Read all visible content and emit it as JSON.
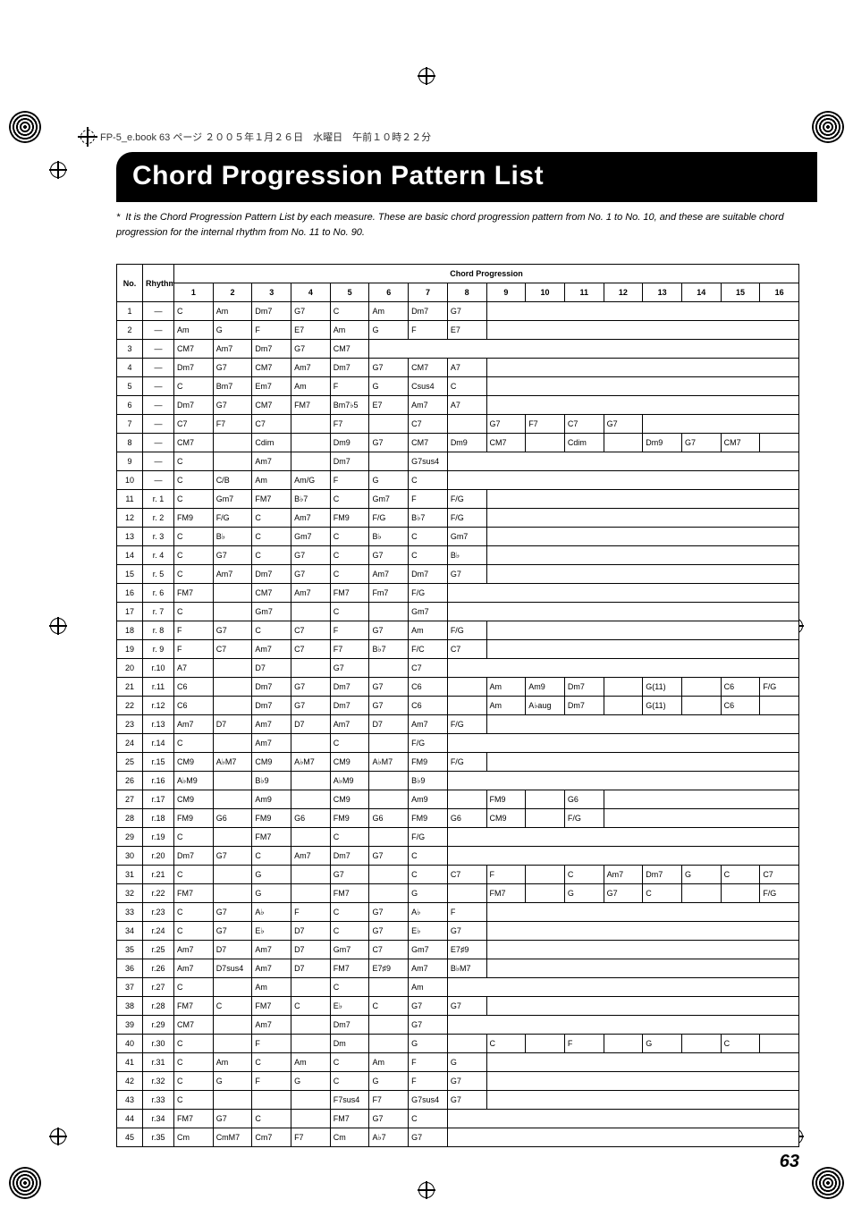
{
  "header": {
    "fileline": "FP-5_e.book 63 ページ ２００５年１月２６日　水曜日　午前１０時２２分"
  },
  "title": "Chord Progression Pattern List",
  "intro_prefix": "*",
  "intro": "It is the Chord Progression Pattern List by each measure. These are basic chord progression pattern from No. 1 to No. 10, and these are suitable chord progression for the internal rhythm from No. 11 to No. 90.",
  "table": {
    "head_no": "No.",
    "head_rhythm": "Rhythm No.",
    "head_chord": "Chord Progression",
    "cols": [
      "1",
      "2",
      "3",
      "4",
      "5",
      "6",
      "7",
      "8",
      "9",
      "10",
      "11",
      "12",
      "13",
      "14",
      "15",
      "16"
    ],
    "rows": [
      {
        "no": "1",
        "r": "—",
        "c": [
          "C",
          "Am",
          "Dm7",
          "G7",
          "C",
          "Am",
          "Dm7",
          "G7"
        ]
      },
      {
        "no": "2",
        "r": "—",
        "c": [
          "Am",
          "G",
          "F",
          "E7",
          "Am",
          "G",
          "F",
          "E7"
        ]
      },
      {
        "no": "3",
        "r": "—",
        "c": [
          "CM7",
          "Am7",
          "Dm7",
          "G7",
          "CM7"
        ]
      },
      {
        "no": "4",
        "r": "—",
        "c": [
          "Dm7",
          "G7",
          "CM7",
          "Am7",
          "Dm7",
          "G7",
          "CM7",
          "A7"
        ]
      },
      {
        "no": "5",
        "r": "—",
        "c": [
          "C",
          "Bm7",
          "Em7",
          "Am",
          "F",
          "G",
          "Csus4",
          "C"
        ]
      },
      {
        "no": "6",
        "r": "—",
        "c": [
          "Dm7",
          "G7",
          "CM7",
          "FM7",
          "Bm7♭5",
          "E7",
          "Am7",
          "A7"
        ]
      },
      {
        "no": "7",
        "r": "—",
        "c": [
          "C7",
          "F7",
          "C7",
          "",
          "F7",
          "",
          "C7",
          "",
          "G7",
          "F7",
          "C7",
          "G7"
        ]
      },
      {
        "no": "8",
        "r": "—",
        "c": [
          "CM7",
          "",
          "Cdim",
          "",
          "Dm9",
          "G7",
          "CM7",
          "Dm9",
          "CM7",
          "",
          "Cdim",
          "",
          "Dm9",
          "G7",
          "CM7"
        ]
      },
      {
        "no": "9",
        "r": "—",
        "c": [
          "C",
          "",
          "Am7",
          "",
          "Dm7",
          "",
          "G7sus4"
        ]
      },
      {
        "no": "10",
        "r": "—",
        "c": [
          "C",
          "C/B",
          "Am",
          "Am/G",
          "F",
          "G",
          "C"
        ]
      },
      {
        "no": "11",
        "r": "r. 1",
        "c": [
          "C",
          "Gm7",
          "FM7",
          "B♭7",
          "C",
          "Gm7",
          "F",
          "F/G"
        ]
      },
      {
        "no": "12",
        "r": "r. 2",
        "c": [
          "FM9",
          "F/G",
          "C",
          "Am7",
          "FM9",
          "F/G",
          "B♭7",
          "F/G"
        ]
      },
      {
        "no": "13",
        "r": "r. 3",
        "c": [
          "C",
          "B♭",
          "C",
          "Gm7",
          "C",
          "B♭",
          "C",
          "Gm7"
        ]
      },
      {
        "no": "14",
        "r": "r. 4",
        "c": [
          "C",
          "G7",
          "C",
          "G7",
          "C",
          "G7",
          "C",
          "B♭"
        ]
      },
      {
        "no": "15",
        "r": "r. 5",
        "c": [
          "C",
          "Am7",
          "Dm7",
          "G7",
          "C",
          "Am7",
          "Dm7",
          "G7"
        ]
      },
      {
        "no": "16",
        "r": "r. 6",
        "c": [
          "FM7",
          "",
          "CM7",
          "Am7",
          "FM7",
          "Fm7",
          "F/G"
        ]
      },
      {
        "no": "17",
        "r": "r. 7",
        "c": [
          "C",
          "",
          "Gm7",
          "",
          "C",
          "",
          "Gm7"
        ]
      },
      {
        "no": "18",
        "r": "r. 8",
        "c": [
          "F",
          "G7",
          "C",
          "C7",
          "F",
          "G7",
          "Am",
          "F/G"
        ]
      },
      {
        "no": "19",
        "r": "r. 9",
        "c": [
          "F",
          "C7",
          "Am7",
          "C7",
          "F7",
          "B♭7",
          "F/C",
          "C7"
        ]
      },
      {
        "no": "20",
        "r": "r.10",
        "c": [
          "A7",
          "",
          "D7",
          "",
          "G7",
          "",
          "C7"
        ]
      },
      {
        "no": "21",
        "r": "r.11",
        "c": [
          "C6",
          "",
          "Dm7",
          "G7",
          "Dm7",
          "G7",
          "C6",
          "",
          "Am",
          "Am9",
          "Dm7",
          "",
          "G(11)",
          "",
          "C6",
          "F/G"
        ]
      },
      {
        "no": "22",
        "r": "r.12",
        "c": [
          "C6",
          "",
          "Dm7",
          "G7",
          "Dm7",
          "G7",
          "C6",
          "",
          "Am",
          "A♭aug",
          "Dm7",
          "",
          "G(11)",
          "",
          "C6"
        ]
      },
      {
        "no": "23",
        "r": "r.13",
        "c": [
          "Am7",
          "D7",
          "Am7",
          "D7",
          "Am7",
          "D7",
          "Am7",
          "F/G"
        ]
      },
      {
        "no": "24",
        "r": "r.14",
        "c": [
          "C",
          "",
          "Am7",
          "",
          "C",
          "",
          "F/G"
        ]
      },
      {
        "no": "25",
        "r": "r.15",
        "c": [
          "CM9",
          "A♭M7",
          "CM9",
          "A♭M7",
          "CM9",
          "A♭M7",
          "FM9",
          "F/G"
        ]
      },
      {
        "no": "26",
        "r": "r.16",
        "c": [
          "A♭M9",
          "",
          "B♭9",
          "",
          "A♭M9",
          "",
          "B♭9"
        ]
      },
      {
        "no": "27",
        "r": "r.17",
        "c": [
          "CM9",
          "",
          "Am9",
          "",
          "CM9",
          "",
          "Am9",
          "",
          "FM9",
          "",
          "G6"
        ]
      },
      {
        "no": "28",
        "r": "r.18",
        "c": [
          "FM9",
          "G6",
          "FM9",
          "G6",
          "FM9",
          "G6",
          "FM9",
          "G6",
          "CM9",
          "",
          "F/G"
        ]
      },
      {
        "no": "29",
        "r": "r.19",
        "c": [
          "C",
          "",
          "FM7",
          "",
          "C",
          "",
          "F/G"
        ]
      },
      {
        "no": "30",
        "r": "r.20",
        "c": [
          "Dm7",
          "G7",
          "C",
          "Am7",
          "Dm7",
          "G7",
          "C"
        ]
      },
      {
        "no": "31",
        "r": "r.21",
        "c": [
          "C",
          "",
          "G",
          "",
          "G7",
          "",
          "C",
          "C7",
          "F",
          "",
          "C",
          "Am7",
          "Dm7",
          "G",
          "C",
          "C7"
        ]
      },
      {
        "no": "32",
        "r": "r.22",
        "c": [
          "FM7",
          "",
          "G",
          "",
          "FM7",
          "",
          "G",
          "",
          "FM7",
          "",
          "G",
          "G7",
          "C",
          "",
          "",
          "F/G"
        ]
      },
      {
        "no": "33",
        "r": "r.23",
        "c": [
          "C",
          "G7",
          "A♭",
          "F",
          "C",
          "G7",
          "A♭",
          "F"
        ]
      },
      {
        "no": "34",
        "r": "r.24",
        "c": [
          "C",
          "G7",
          "E♭",
          "D7",
          "C",
          "G7",
          "E♭",
          "G7"
        ]
      },
      {
        "no": "35",
        "r": "r.25",
        "c": [
          "Am7",
          "D7",
          "Am7",
          "D7",
          "Gm7",
          "C7",
          "Gm7",
          "E7♯9"
        ]
      },
      {
        "no": "36",
        "r": "r.26",
        "c": [
          "Am7",
          "D7sus4",
          "Am7",
          "D7",
          "FM7",
          "E7♯9",
          "Am7",
          "B♭M7"
        ]
      },
      {
        "no": "37",
        "r": "r.27",
        "c": [
          "C",
          "",
          "Am",
          "",
          "C",
          "",
          "Am"
        ]
      },
      {
        "no": "38",
        "r": "r.28",
        "c": [
          "FM7",
          "C",
          "FM7",
          "C",
          "E♭",
          "C",
          "G7",
          "G7"
        ]
      },
      {
        "no": "39",
        "r": "r.29",
        "c": [
          "CM7",
          "",
          "Am7",
          "",
          "Dm7",
          "",
          "G7"
        ]
      },
      {
        "no": "40",
        "r": "r.30",
        "c": [
          "C",
          "",
          "F",
          "",
          "Dm",
          "",
          "G",
          "",
          "C",
          "",
          "F",
          "",
          "G",
          "",
          "C"
        ]
      },
      {
        "no": "41",
        "r": "r.31",
        "c": [
          "C",
          "Am",
          "C",
          "Am",
          "C",
          "Am",
          "F",
          "G"
        ]
      },
      {
        "no": "42",
        "r": "r.32",
        "c": [
          "C",
          "G",
          "F",
          "G",
          "C",
          "G",
          "F",
          "G7"
        ]
      },
      {
        "no": "43",
        "r": "r.33",
        "c": [
          "C",
          "",
          "",
          "",
          "F7sus4",
          "F7",
          "G7sus4",
          "G7"
        ]
      },
      {
        "no": "44",
        "r": "r.34",
        "c": [
          "FM7",
          "G7",
          "C",
          "",
          "FM7",
          "G7",
          "C"
        ]
      },
      {
        "no": "45",
        "r": "r.35",
        "c": [
          "Cm",
          "CmM7",
          "Cm7",
          "F7",
          "Cm",
          "A♭7",
          "G7"
        ]
      }
    ]
  },
  "page_number": "63"
}
